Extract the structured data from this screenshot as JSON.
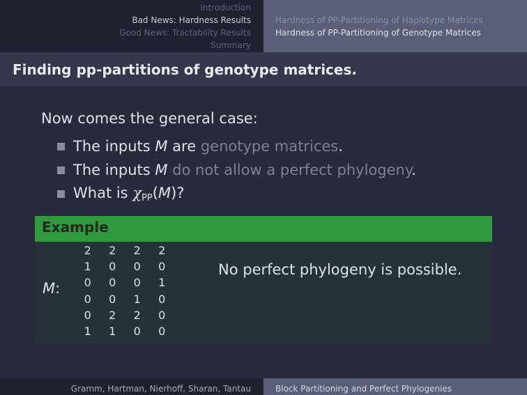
{
  "nav": {
    "sections": [
      {
        "label": "Introduction",
        "active": false
      },
      {
        "label": "Bad News: Hardness Results",
        "active": true
      },
      {
        "label": "Good News: Tractability Results",
        "active": false
      },
      {
        "label": "Summary",
        "active": false
      }
    ],
    "subsections": [
      {
        "label": "Hardness of PP-Partitioning of Haplotype Matrices",
        "active": false
      },
      {
        "label": "Hardness of PP-Partitioning of Genotype Matrices",
        "active": true
      }
    ]
  },
  "frame": {
    "title": "Finding pp-partitions of genotype matrices."
  },
  "body": {
    "intro": "Now comes the general case:",
    "bullets": [
      {
        "prefix": "The inputs ",
        "math": "M",
        "mid": " are ",
        "highlight": "genotype matrices",
        "suffix": "."
      },
      {
        "prefix": "The inputs ",
        "math": "M",
        "mid": " ",
        "highlight": "do not allow a perfect phylogeny",
        "suffix": "."
      },
      {
        "prefix": "What is ",
        "chi": "χ",
        "sub": "PP",
        "open": "(",
        "math": "M",
        "close": ")?"
      }
    ]
  },
  "example": {
    "title": "Example",
    "matrix_label": "M",
    "matrix_sep": ":",
    "matrix": [
      [
        "2",
        "2",
        "2",
        "2"
      ],
      [
        "1",
        "0",
        "0",
        "0"
      ],
      [
        "0",
        "0",
        "0",
        "1"
      ],
      [
        "0",
        "0",
        "1",
        "0"
      ],
      [
        "0",
        "2",
        "2",
        "0"
      ],
      [
        "1",
        "1",
        "0",
        "0"
      ]
    ],
    "note": "No perfect phylogeny is possible."
  },
  "footer": {
    "authors": "Gramm, Hartman, Nierhoff, Sharan, Tantau",
    "talk_title": "Block Partitioning and Perfect Phylogenies"
  },
  "colors": {
    "background": "#272a3a",
    "nav_left": "#1e2130",
    "nav_right": "#5a5e78",
    "title_bar": "#34374a",
    "example_header": "#2e9a3d",
    "example_body": "#253338",
    "highlight_text": "#7d8193"
  }
}
